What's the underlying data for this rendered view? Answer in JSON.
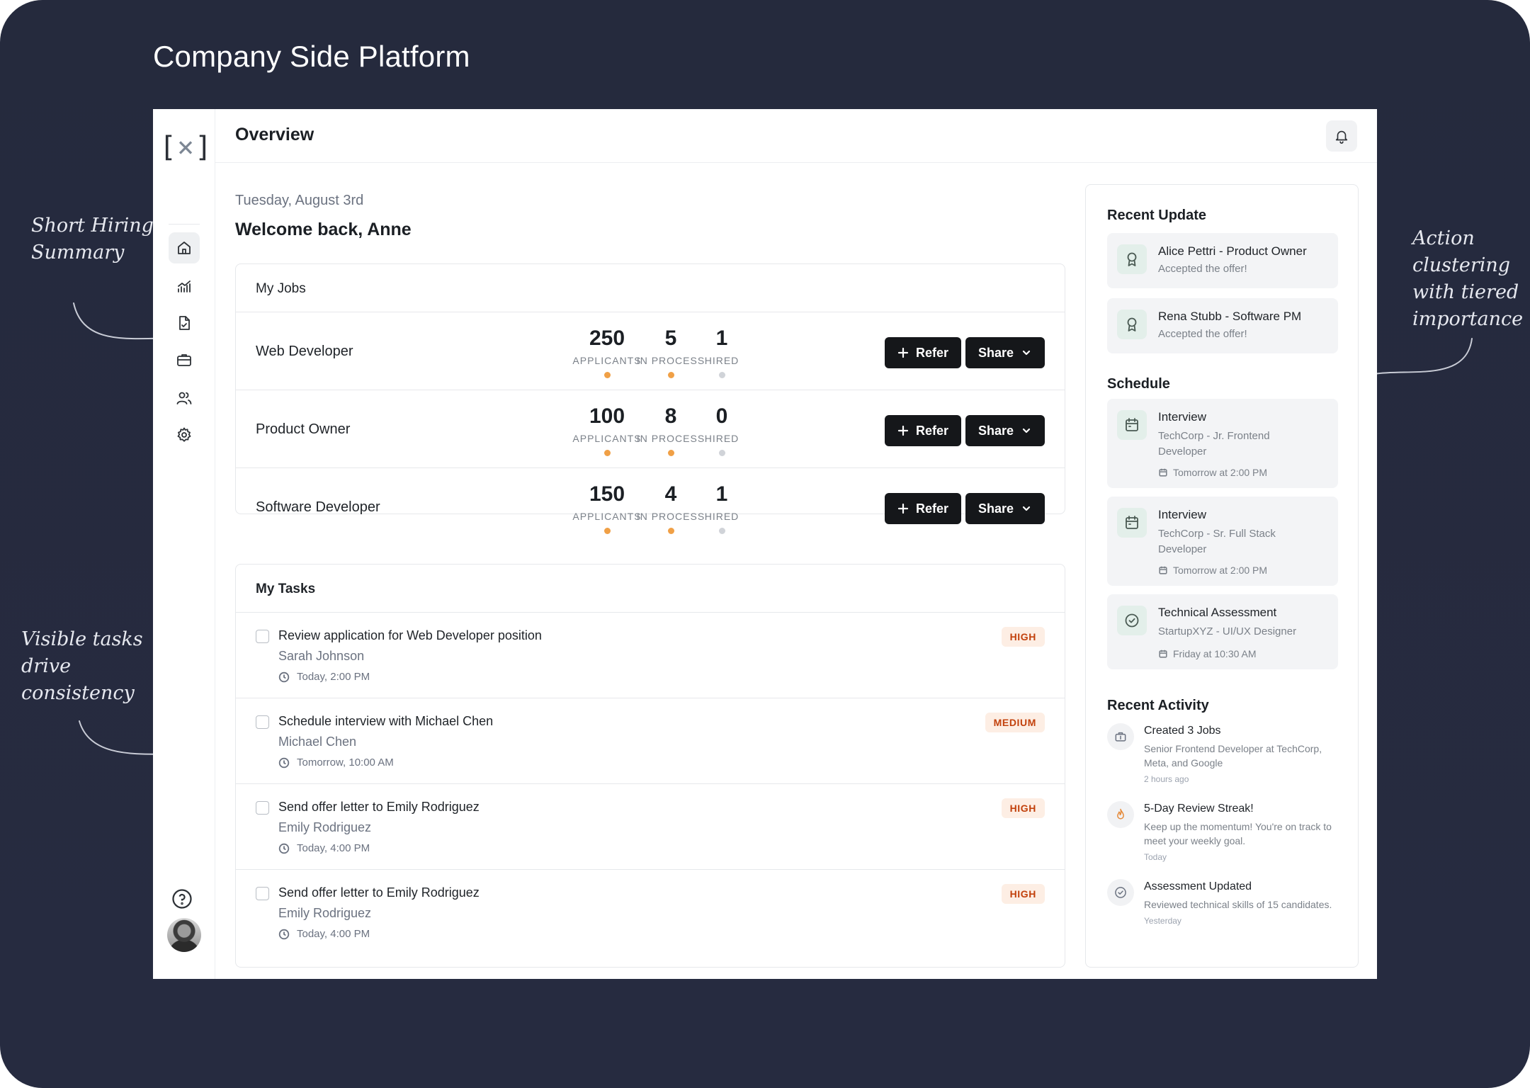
{
  "headline": "Company Side Platform",
  "annotations": {
    "left_top": "Short Hiring Summary",
    "left_bottom": "Visible tasks drive consistency",
    "right": "Action clustering with tiered importance"
  },
  "app": {
    "logo_left": "[",
    "logo_mid": "×",
    "logo_right": "]",
    "page_title": "Overview",
    "nav_icons": [
      "home-icon",
      "analytics-icon",
      "document-icon",
      "briefcase-icon",
      "users-icon",
      "gear-icon"
    ],
    "date": "Tuesday, August 3rd",
    "welcome": "Welcome back, Anne"
  },
  "jobs": {
    "title": "My Jobs",
    "labels": {
      "applicants": "APPLICANTS",
      "in_process": "IN PROCESS",
      "hired": "HIRED"
    },
    "refer_label": "Refer",
    "share_label": "Share",
    "rows": [
      {
        "title": "Web Developer",
        "applicants": "250",
        "in_process": "5",
        "hired": "1"
      },
      {
        "title": "Product Owner",
        "applicants": "100",
        "in_process": "8",
        "hired": "0"
      },
      {
        "title": "Software Developer",
        "applicants": "150",
        "in_process": "4",
        "hired": "1"
      }
    ]
  },
  "tasks": {
    "title": "My Tasks",
    "rows": [
      {
        "title": "Review application for Web Developer position",
        "person": "Sarah Johnson",
        "time": "Today, 2:00 PM",
        "priority": "HIGH"
      },
      {
        "title": "Schedule interview with Michael Chen",
        "person": "Michael Chen",
        "time": "Tomorrow, 10:00 AM",
        "priority": "MEDIUM"
      },
      {
        "title": "Send offer letter to Emily Rodriguez",
        "person": "Emily Rodriguez",
        "time": "Today, 4:00 PM",
        "priority": "HIGH"
      },
      {
        "title": "Send offer letter to Emily Rodriguez",
        "person": "Emily Rodriguez",
        "time": "Today, 4:00 PM",
        "priority": "HIGH"
      }
    ]
  },
  "recent_update": {
    "title": "Recent Update",
    "items": [
      {
        "name": "Alice Pettri - Product Owner",
        "status": "Accepted the offer!"
      },
      {
        "name": "Rena Stubb - Software PM",
        "status": "Accepted the offer!"
      }
    ]
  },
  "schedule": {
    "title": "Schedule",
    "items": [
      {
        "type": "Interview",
        "detail": "TechCorp - Jr. Frontend Developer",
        "time": "Tomorrow at 2:00 PM"
      },
      {
        "type": "Interview",
        "detail": "TechCorp - Sr. Full Stack Developer",
        "time": "Tomorrow at 2:00 PM"
      },
      {
        "type": "Technical Assessment",
        "detail": "StartupXYZ - UI/UX Designer",
        "time": "Friday at 10:30 AM"
      }
    ]
  },
  "recent_activity": {
    "title": "Recent Activity",
    "items": [
      {
        "title": "Created 3 Jobs",
        "desc": "Senior Frontend Developer at TechCorp, Meta, and Google",
        "when": "2 hours ago"
      },
      {
        "title": "5-Day Review Streak!",
        "desc": "Keep up the momentum! You're on track to meet your weekly goal.",
        "when": "Today"
      },
      {
        "title": "Assessment Updated",
        "desc": "Reviewed technical skills of 15 candidates.",
        "when": "Yesterday"
      }
    ]
  }
}
